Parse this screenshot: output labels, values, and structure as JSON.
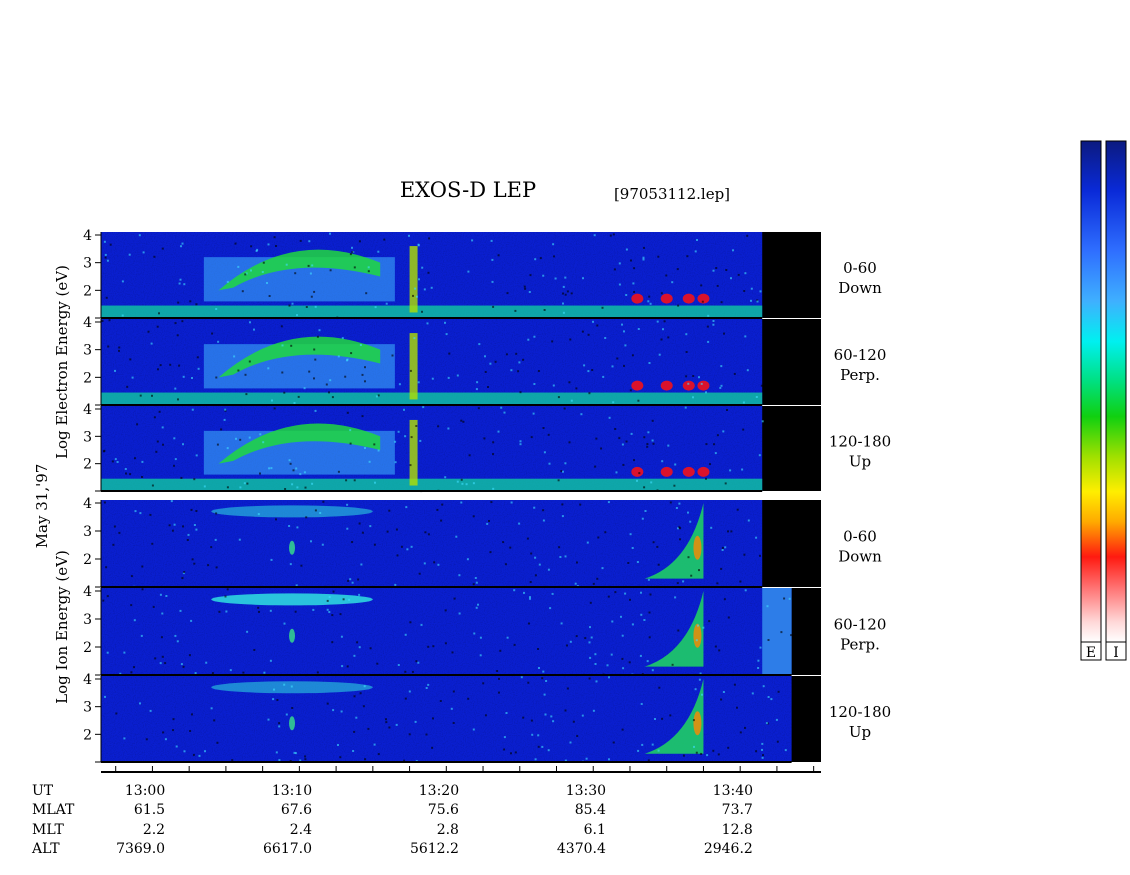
{
  "title": "EXOS-D LEP",
  "file_label": "[97053112.lep]",
  "date_label": "May 31,'97",
  "species_labels": [
    "Log   Electron   Energy (eV)",
    "Log   Ion   Energy (eV)"
  ],
  "panels": [
    {
      "species": "electron",
      "label_line1": "0-60",
      "label_line2": "Down"
    },
    {
      "species": "electron",
      "label_line1": "60-120",
      "label_line2": "Perp."
    },
    {
      "species": "electron",
      "label_line1": "120-180",
      "label_line2": "Up"
    },
    {
      "species": "ion",
      "label_line1": "0-60",
      "label_line2": "Down"
    },
    {
      "species": "ion",
      "label_line1": "60-120",
      "label_line2": "Perp."
    },
    {
      "species": "ion",
      "label_line1": "120-180",
      "label_line2": "Up"
    }
  ],
  "ephemeris": {
    "row_labels": [
      "UT",
      "MLAT",
      "MLT",
      "ALT"
    ],
    "columns": [
      {
        "ut": "13:00",
        "mlat": "61.5",
        "mlt": "2.2",
        "alt": "7369.0"
      },
      {
        "ut": "13:10",
        "mlat": "67.6",
        "mlt": "2.4",
        "alt": "6617.0"
      },
      {
        "ut": "13:20",
        "mlat": "75.6",
        "mlt": "2.8",
        "alt": "5612.2"
      },
      {
        "ut": "13:30",
        "mlat": "85.4",
        "mlt": "6.1",
        "alt": "4370.4"
      },
      {
        "ut": "13:40",
        "mlat": "73.7",
        "mlt": "12.8",
        "alt": "2946.2"
      }
    ]
  },
  "colorbar_labels": [
    "E",
    "I"
  ],
  "colors": {
    "background_low": "#0a1fd0",
    "high_flux": "#ff1010",
    "no_data": "#000000"
  },
  "chart_data": {
    "type": "heatmap",
    "x_unit": "UT (minutes)",
    "xlim": [
      "12:57",
      "13:46"
    ],
    "x_ticks": [
      "13:00",
      "13:10",
      "13:20",
      "13:30",
      "13:40"
    ],
    "y_scale": "log10 energy (eV)",
    "ylim": [
      1,
      4
    ],
    "y_ticks": [
      2,
      3,
      4
    ],
    "electron_data_end": "13:42",
    "ion_perp_up_data_end": "13:44"
  }
}
